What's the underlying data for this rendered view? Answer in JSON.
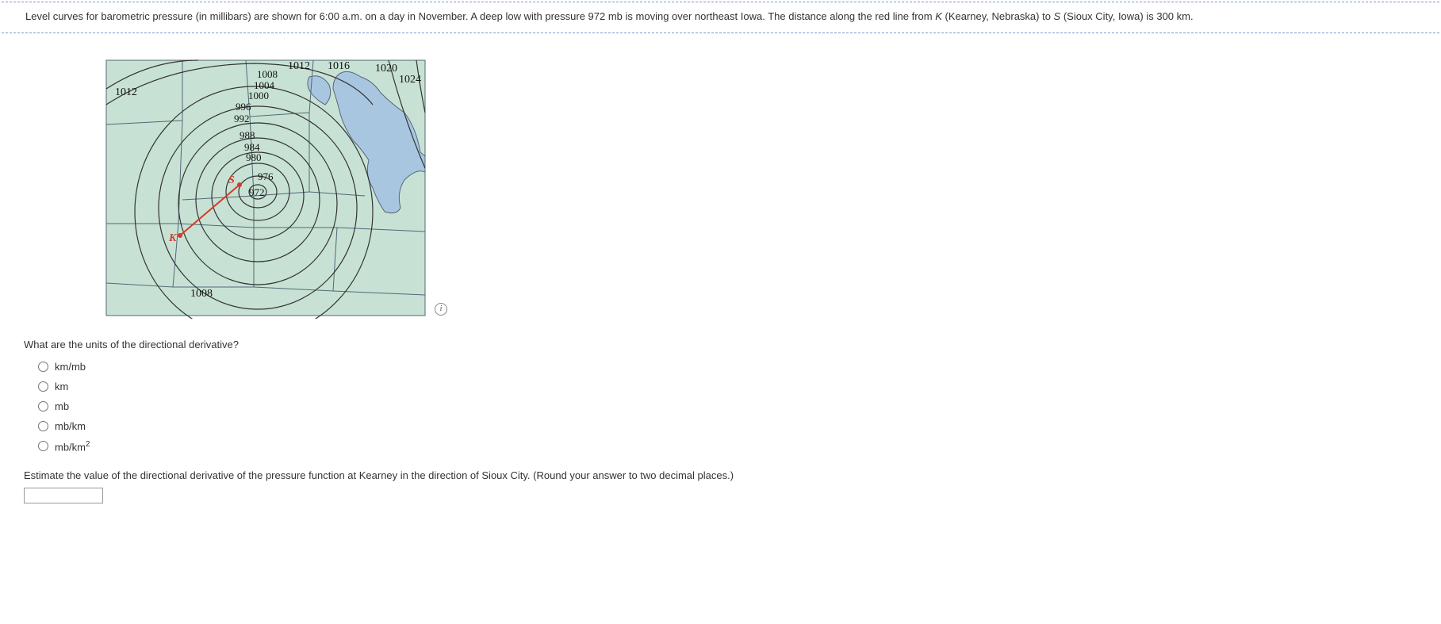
{
  "problem": {
    "text_before_K": "Level curves for barometric pressure (in millibars) are shown for 6:00 a.m. on a day in November. A deep low with pressure 972 mb is moving over northeast Iowa. The distance along the red line from ",
    "K": "K",
    "text_after_K": " (Kearney, Nebraska) to ",
    "S": "S",
    "text_after_S": " (Sioux City, Iowa) is 300 km."
  },
  "map": {
    "labels": {
      "l1012_left": "1012",
      "l1008": "1008",
      "l1012_top": "1012",
      "l1016": "1016",
      "l1020": "1020",
      "l1024": "1024",
      "l1008_top": "1008",
      "l1004": "1004",
      "l1000": "1000",
      "l996": "996",
      "l992": "992",
      "l988": "988",
      "l984": "984",
      "l980": "980",
      "l976": "976",
      "l972": "972",
      "K": "K",
      "S": "S"
    }
  },
  "info_icon": "i",
  "question1": "What are the units of the directional derivative?",
  "options": [
    "km/mb",
    "km",
    "mb",
    "mb/km",
    "mb/km²"
  ],
  "question2": "Estimate the value of the directional derivative of the pressure function at Kearney in the direction of Sioux City. (Round your answer to two decimal places.)",
  "answer_value": ""
}
